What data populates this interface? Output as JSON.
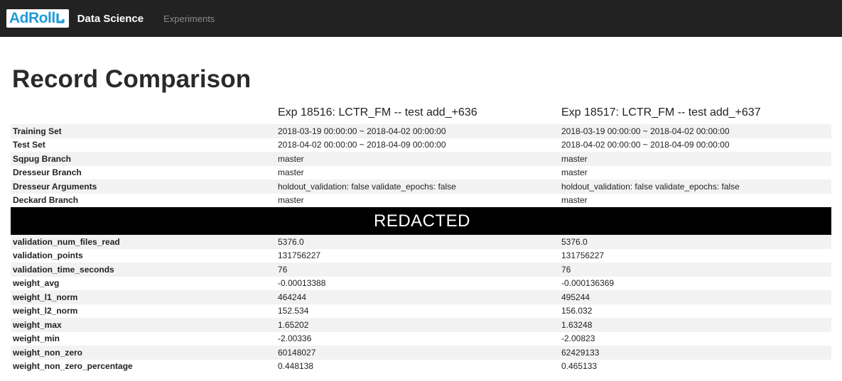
{
  "nav": {
    "logo_ad": "Ad",
    "logo_roll": "Roll",
    "brand": "Data Science",
    "links": [
      "Experiments"
    ]
  },
  "page_title": "Record Comparison",
  "columns": [
    "Exp 18516: LCTR_FM -- test add_+636",
    "Exp 18517: LCTR_FM -- test add_+637"
  ],
  "rows_top": [
    {
      "label": "Training Set",
      "values": [
        "2018-03-19 00:00:00 ~ 2018-04-02 00:00:00",
        "2018-03-19 00:00:00 ~ 2018-04-02 00:00:00"
      ]
    },
    {
      "label": "Test Set",
      "values": [
        "2018-04-02 00:00:00 ~ 2018-04-09 00:00:00",
        "2018-04-02 00:00:00 ~ 2018-04-09 00:00:00"
      ]
    },
    {
      "label": "Sqpug Branch",
      "values": [
        "master",
        "master"
      ]
    },
    {
      "label": "Dresseur Branch",
      "values": [
        "master",
        "master"
      ]
    },
    {
      "label": "Dresseur Arguments",
      "values": [
        "holdout_validation: false validate_epochs: false",
        "holdout_validation: false validate_epochs: false"
      ]
    },
    {
      "label": "Deckard Branch",
      "values": [
        "master",
        "master"
      ]
    }
  ],
  "redacted_label": "REDACTED",
  "rows_bottom": [
    {
      "label": "validation_num_files_read",
      "values": [
        "5376.0",
        "5376.0"
      ]
    },
    {
      "label": "validation_points",
      "values": [
        "131756227",
        "131756227"
      ]
    },
    {
      "label": "validation_time_seconds",
      "values": [
        "76",
        "76"
      ]
    },
    {
      "label": "weight_avg",
      "values": [
        "-0.00013388",
        "-0.000136369"
      ]
    },
    {
      "label": "weight_l1_norm",
      "values": [
        "464244",
        "495244"
      ]
    },
    {
      "label": "weight_l2_norm",
      "values": [
        "152.534",
        "156.032"
      ]
    },
    {
      "label": "weight_max",
      "values": [
        "1.65202",
        "1.63248"
      ]
    },
    {
      "label": "weight_min",
      "values": [
        "-2.00336",
        "-2.00823"
      ]
    },
    {
      "label": "weight_non_zero",
      "values": [
        "60148027",
        "62429133"
      ]
    },
    {
      "label": "weight_non_zero_percentage",
      "values": [
        "0.448138",
        "0.465133"
      ]
    }
  ]
}
